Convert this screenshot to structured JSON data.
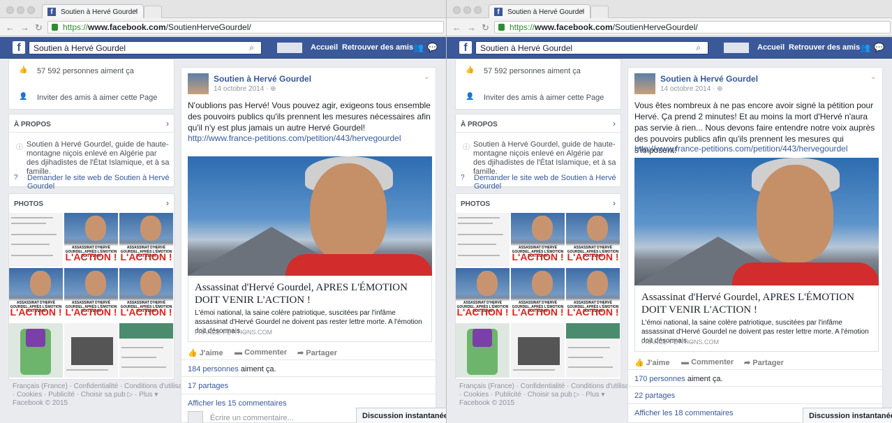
{
  "tab_title": "Soutien à Hervé Gourdel",
  "url": {
    "scheme": "https://",
    "host": "www.facebook.com",
    "path": "/SoutienHerveGourdel/"
  },
  "fb": {
    "search": "Soutien à Hervé Gourdel",
    "nav_home": "Accueil",
    "nav_friends": "Retrouver des amis"
  },
  "left": {
    "likes": "57 592 personnes aiment ça",
    "invite": "Inviter des amis à aimer cette Page",
    "about_header": "À PROPOS",
    "about_text": "Soutien à Hervé Gourdel, guide de haute-montagne niçois enlevé en Algérie par des djihadistes de l'État Islamique, et à sa famille.",
    "about_link": "Demander le site web de Soutien à Hervé Gourdel",
    "photos_header": "PHOTOS",
    "photo_tile_small": "ASSASSINAT D'HERVÉ GOURDEL, APRÈS L'ÉMOTION DOIT VENIR",
    "photo_tile_big": "L'ACTION !",
    "footer_1": "Français (France) · Confidentialité · Conditions d'utilisation",
    "footer_2": "· Cookies · Publicité · Choisir sa pub ▷ · Plus ▾",
    "footer_3": "Facebook © 2015"
  },
  "posts": [
    {
      "author": "Soutien à Hervé Gourdel",
      "date": "14 octobre 2014 · ",
      "text": "N'oublions pas Hervé! Vous pouvez agir, exigeons tous ensemble des pouvoirs publics qu'ils prennent les mesures nécessaires afin qu'il n'y est plus jamais un autre Hervé Gourdel!",
      "link": "http://www.france-petitions.com/petition/443/hervegourdel",
      "likes_link": "184 personnes",
      "likes_rest": " aiment ça.",
      "shares": "17 partages",
      "comments": "Afficher les 15 commentaires"
    },
    {
      "author": "Soutien à Hervé Gourdel",
      "date": "14 octobre 2014 · ",
      "text": "Vous êtes nombreux à ne pas encore avoir signé la pétition pour Hervé. Ça prend 2 minutes! Et au moins la mort d'Hervé n'aura pas servie à rien... Nous devons faire entendre notre voix auprès des pouvoirs publics afin qu'ils prennent les mesures qui s'imposent!",
      "link": "http://www.france-petitions.com/petition/443/hervegourdel",
      "likes_link": "170 personnes",
      "likes_rest": " aiment ça.",
      "shares": "22 partages",
      "comments": "Afficher les 18 commentaires"
    }
  ],
  "shared_link": {
    "title": "Assassinat d'Hervé Gourdel, APRES L'ÉMOTION DOIT VENIR L'ACTION !",
    "desc": "L'émoi national, la saine colère patriotique, suscitées par l'infâme assassinat d'Hervé Gourdel ne doivent pas rester lettre morte. A l'émotion doit désormais...",
    "source": "FRANCE-PETITIONS.COM"
  },
  "actions": {
    "like": "J'aime",
    "comment": "Commenter",
    "share": "Partager"
  },
  "comment_placeholder": "Écrire un commentaire...",
  "chat": "Discussion instantanée (Off)"
}
